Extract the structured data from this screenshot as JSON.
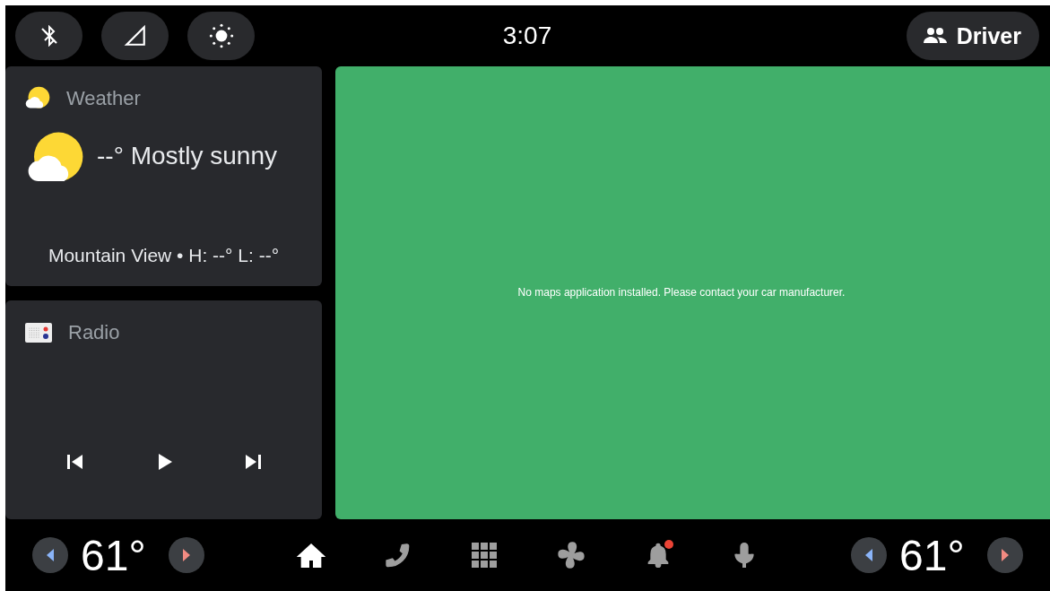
{
  "status_bar": {
    "quick_controls": [
      {
        "kind": "bluetooth",
        "on": false
      },
      {
        "kind": "signal"
      },
      {
        "kind": "brightness"
      }
    ],
    "time": "3:07",
    "profile": {
      "label": "Driver"
    }
  },
  "weather_card": {
    "title": "Weather",
    "condition": "--° Mostly sunny",
    "details": "Mountain View • H: --° L: --°"
  },
  "radio_card": {
    "title": "Radio",
    "controls": [
      {
        "kind": "previous"
      },
      {
        "kind": "play"
      },
      {
        "kind": "next"
      }
    ]
  },
  "map": {
    "message": "No maps application installed. Please contact your car manufacturer."
  },
  "nav_bar": {
    "climate_left": {
      "temperature": "61°"
    },
    "items": [
      {
        "kind": "home",
        "selected": true
      },
      {
        "kind": "phone",
        "selected": false
      },
      {
        "kind": "apps",
        "selected": false
      },
      {
        "kind": "fan",
        "selected": false
      },
      {
        "kind": "notifications",
        "selected": false,
        "unread": true
      },
      {
        "kind": "voice",
        "selected": false
      }
    ],
    "climate_right": {
      "temperature": "61°"
    }
  }
}
